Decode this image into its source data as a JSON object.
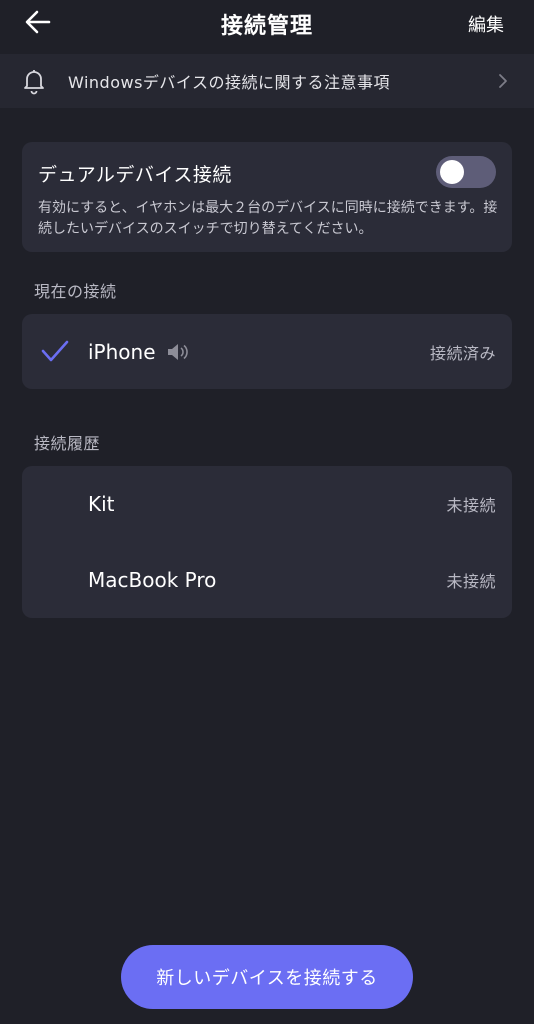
{
  "header": {
    "title": "接続管理",
    "edit_label": "編集"
  },
  "notice": {
    "text": "Windowsデバイスの接続に関する注意事項"
  },
  "dual_device": {
    "label": "デュアルデバイス接続",
    "enabled": false,
    "description": "有効にすると、イヤホンは最大２台のデバイスに同時に接続できます。接続したいデバイスのスイッチで切り替えてください。"
  },
  "current": {
    "section_label": "現在の接続",
    "device": {
      "name": "iPhone",
      "status": "接続済み"
    }
  },
  "history": {
    "section_label": "接続履歴",
    "devices": [
      {
        "name": "Kit",
        "status": "未接続"
      },
      {
        "name": "MacBook Pro",
        "status": "未接続"
      }
    ]
  },
  "primary_button": {
    "label": "新しいデバイスを接続する"
  },
  "colors": {
    "background": "#1f2028",
    "card": "#2b2c38",
    "accent": "#6b6ef3",
    "toggle_off": "#5e5d78"
  },
  "icons": [
    "back-arrow-icon",
    "bell-icon",
    "chevron-right-icon",
    "checkmark-icon",
    "speaker-icon"
  ]
}
